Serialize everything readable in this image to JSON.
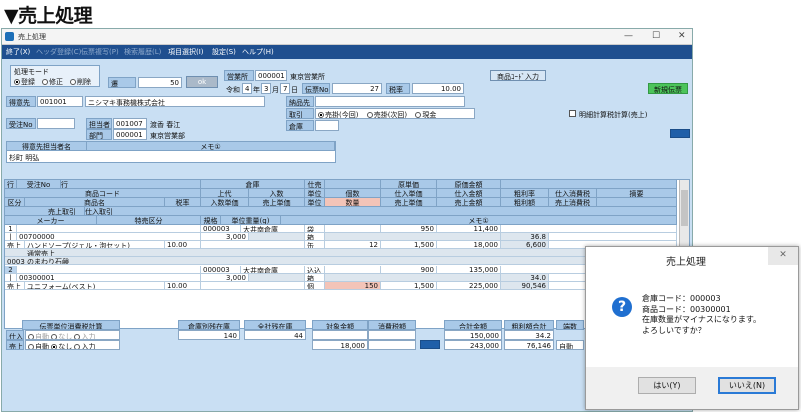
{
  "heading": "▼売上処理",
  "window": {
    "title": "売上処理",
    "minimize": "—",
    "maximize": "☐",
    "close": "✕"
  },
  "menu": [
    {
      "label": "終了(X)",
      "enabled": true
    },
    {
      "label": "ヘッダ登録(C)",
      "enabled": false
    },
    {
      "label": "伝票複写(P)",
      "enabled": false
    },
    {
      "label": "検索履歴(L)",
      "enabled": false
    },
    {
      "label": "項目選択(I)",
      "enabled": true
    },
    {
      "label": "設定(S)",
      "enabled": true
    },
    {
      "label": "ヘルプ(H)",
      "enabled": true
    }
  ],
  "mode": {
    "label": "処理モード",
    "options": [
      "登録",
      "修正",
      "削除"
    ],
    "selected": 0
  },
  "nav": {
    "label": "遷",
    "value": "50",
    "button": "ok"
  },
  "office": {
    "label": "営業所",
    "code": "000001",
    "name": "東京営業所"
  },
  "date": {
    "era": "令和",
    "year": "4",
    "year_unit": "年",
    "month": "3",
    "month_unit": "月",
    "day": "7",
    "day_unit": "日"
  },
  "slip": {
    "label": "伝票No",
    "value": "27"
  },
  "tax": {
    "label": "税率",
    "value": "10.00"
  },
  "product_code_btn": "商品ｺｰﾄﾞ入力",
  "new_slip_btn": "新規伝票",
  "customer": {
    "label": "得意先",
    "code": "001001",
    "name": "ニシマキ事務機株式会社"
  },
  "delivery": {
    "label": "納品先"
  },
  "trade": {
    "label": "取引",
    "options": [
      "売掛(今回)",
      "売掛(次回)",
      "現金"
    ],
    "selected": 0
  },
  "order_no": {
    "label": "受注No"
  },
  "staff": {
    "label": "担当者",
    "code": "001007",
    "name": "渡香 春江"
  },
  "dept": {
    "label": "部門",
    "code": "000001",
    "name": "東京営業部"
  },
  "warehouse": {
    "label": "倉庫"
  },
  "detail_tax": {
    "label": "明細計算税計算(売上)"
  },
  "contact": {
    "headers": [
      "得意先担当者名",
      "メモ①"
    ],
    "value": "杉町 明弘"
  },
  "grid": {
    "hdr1": [
      "行",
      "受注No",
      "行",
      "",
      "倉庫",
      "仕売",
      "原単価",
      "原価金額",
      "",
      "",
      ""
    ],
    "hdr2": [
      "商品コード",
      "上代",
      "入数",
      "単位",
      "個数",
      "仕入単価",
      "仕入金額",
      "粗利率",
      "仕入消費税",
      "摘要"
    ],
    "hdr3": [
      "区分",
      "商品名",
      "税率",
      "入数単価",
      "売上単価",
      "単位",
      "数量",
      "売上単価",
      "売上金額",
      "粗利額",
      "売上消費税"
    ],
    "hdr4": [
      "売上取引",
      "仕入取引"
    ],
    "hdr5": [
      "メーカー",
      "特売区分",
      "規格",
      "単位重量(g)",
      "メモ①"
    ],
    "rows": [
      {
        "no": "1",
        "wh_code": "000003",
        "wh_name": "大井南倉庫",
        "unit1": "袋",
        "cost": "950",
        "cost_amt": "11,400",
        "code": "00700000",
        "price": "3,000",
        "unit2": "箱",
        "margin": "36.8",
        "kind": "売上",
        "name": "ハンドソープ(ジェル・泡セット)",
        "rate": "10.00",
        "unit3": "缶",
        "qty": "12",
        "sell": "1,500",
        "sell_amt": "18,000",
        "gross": "6,600",
        "maker": "通常売上",
        "memo": "0003 のまわり石鹸"
      },
      {
        "no": "2",
        "wh_code": "000003",
        "wh_name": "大井南倉庫",
        "unit1": "込込",
        "cost": "900",
        "cost_amt": "135,000",
        "code": "00300001",
        "price": "3,000",
        "unit2": "箱",
        "margin": "34.0",
        "kind": "売上",
        "name": "ユニフォーム(ベスト)",
        "rate": "10.00",
        "unit3": "個",
        "qty": "150",
        "sell": "1,500",
        "sell_amt": "225,000",
        "gross": "90,546"
      }
    ]
  },
  "footer": {
    "tax_calc": "伝票単位消費税計算",
    "in_label": "仕入",
    "out_label": "売上",
    "in_opts": [
      "自動",
      "なし",
      "入力"
    ],
    "out_opts": [
      "自動",
      "なし",
      "入力"
    ],
    "stock_out": "倉庫別残在庫",
    "stock_out_val": "140",
    "stock_all": "全社残在庫",
    "stock_all_val": "44",
    "target": "対象金額",
    "target_val": "18,000",
    "consume": "消費税額",
    "total": "合計金額",
    "total_in": "150,000",
    "total_out": "243,000",
    "gross_total": "粗利額合計",
    "gross_in": "34.2",
    "gross_out": "76,146",
    "fraction": "端数",
    "fraction_val": "自動"
  },
  "dialog": {
    "title": "売上処理",
    "line1": "倉庫コード：000003",
    "line2": "商品コード：00300001",
    "line3": "在庫数量がマイナスになります。",
    "line4": "よろしいですか？",
    "yes": "はい(Y)",
    "no": "いいえ(N)"
  },
  "colors": {
    "accent": "#1f4f8f",
    "header": "#a9c9e8",
    "panel": "#c9dff3"
  }
}
